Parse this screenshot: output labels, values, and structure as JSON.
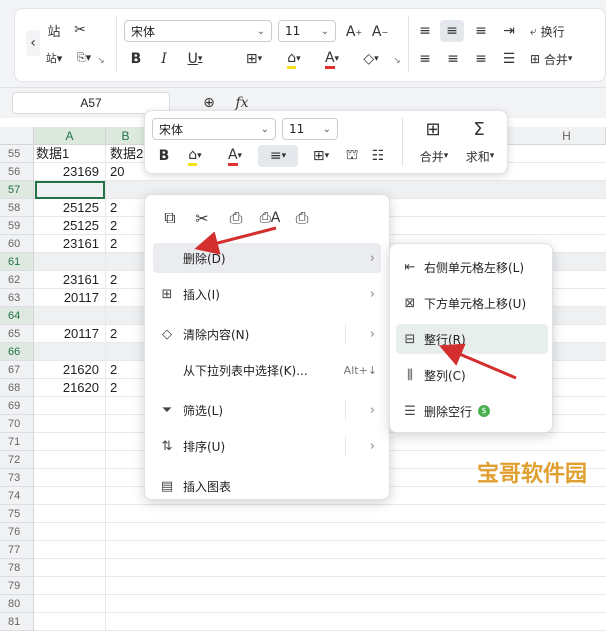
{
  "ribbon": {
    "font_name": "宋体",
    "font_size": "11",
    "buttons": {
      "bold": "B",
      "italic": "I",
      "underline": "U",
      "font_grow": "A⁺",
      "font_shrink": "A⁻",
      "font_color_letter": "A",
      "wrap_text": "换行",
      "merge": "合并"
    }
  },
  "formula_bar": {
    "name_box": "A57",
    "fx": "fx"
  },
  "columns": [
    "A",
    "B",
    "H"
  ],
  "rows": [
    {
      "num": "55",
      "a": "数据1",
      "b": "数据2",
      "hl": false
    },
    {
      "num": "56",
      "a": "23169",
      "b": "20",
      "hl": false
    },
    {
      "num": "57",
      "a": "",
      "b": "",
      "hl": true
    },
    {
      "num": "58",
      "a": "25125",
      "b": "2",
      "hl": false
    },
    {
      "num": "59",
      "a": "25125",
      "b": "2",
      "hl": false
    },
    {
      "num": "60",
      "a": "23161",
      "b": "2",
      "hl": false
    },
    {
      "num": "61",
      "a": "",
      "b": "",
      "hl": true
    },
    {
      "num": "62",
      "a": "23161",
      "b": "2",
      "hl": false
    },
    {
      "num": "63",
      "a": "20117",
      "b": "2",
      "hl": false
    },
    {
      "num": "64",
      "a": "",
      "b": "",
      "hl": true
    },
    {
      "num": "65",
      "a": "20117",
      "b": "2",
      "hl": false
    },
    {
      "num": "66",
      "a": "",
      "b": "",
      "hl": true
    },
    {
      "num": "67",
      "a": "21620",
      "b": "2",
      "hl": false
    },
    {
      "num": "68",
      "a": "21620",
      "b": "2",
      "hl": false
    },
    {
      "num": "69",
      "a": "",
      "b": "",
      "hl": false
    },
    {
      "num": "70",
      "a": "",
      "b": "",
      "hl": false
    },
    {
      "num": "71",
      "a": "",
      "b": "",
      "hl": false
    },
    {
      "num": "72",
      "a": "",
      "b": "",
      "hl": false
    },
    {
      "num": "73",
      "a": "",
      "b": "",
      "hl": false
    },
    {
      "num": "74",
      "a": "",
      "b": "",
      "hl": false
    },
    {
      "num": "75",
      "a": "",
      "b": "",
      "hl": false
    },
    {
      "num": "76",
      "a": "",
      "b": "",
      "hl": false
    },
    {
      "num": "77",
      "a": "",
      "b": "",
      "hl": false
    },
    {
      "num": "78",
      "a": "",
      "b": "",
      "hl": false
    },
    {
      "num": "79",
      "a": "",
      "b": "",
      "hl": false
    },
    {
      "num": "80",
      "a": "",
      "b": "",
      "hl": false
    },
    {
      "num": "81",
      "a": "",
      "b": "",
      "hl": false
    }
  ],
  "mini_toolbar": {
    "font_name": "宋体",
    "font_size": "11",
    "bold": "B",
    "font_color_letter": "A",
    "merge": "合并",
    "sum": "求和"
  },
  "context_menu": {
    "items": [
      {
        "label": "删除(D)",
        "shortcut": "",
        "submenu": true
      },
      {
        "label": "插入(I)",
        "shortcut": "",
        "submenu": true
      },
      {
        "label": "清除内容(N)",
        "shortcut": "",
        "submenu": true
      },
      {
        "label": "从下拉列表中选择(K)...",
        "shortcut": "Alt+↓",
        "submenu": false
      },
      {
        "label": "筛选(L)",
        "shortcut": "",
        "submenu": true
      },
      {
        "label": "排序(U)",
        "shortcut": "",
        "submenu": true
      },
      {
        "label": "插入图表",
        "shortcut": "",
        "submenu": false
      }
    ]
  },
  "delete_submenu": {
    "items": [
      {
        "label": "右侧单元格左移(L)"
      },
      {
        "label": "下方单元格上移(U)"
      },
      {
        "label": "整行(R)"
      },
      {
        "label": "整列(C)"
      },
      {
        "label": "删除空行"
      }
    ]
  },
  "watermark": "宝哥软件园",
  "colors": {
    "accent_green": "#217346",
    "arrow_red": "#d32f2f",
    "font_color_red": "#e03030",
    "highlight_yellow": "#f5e11a"
  }
}
